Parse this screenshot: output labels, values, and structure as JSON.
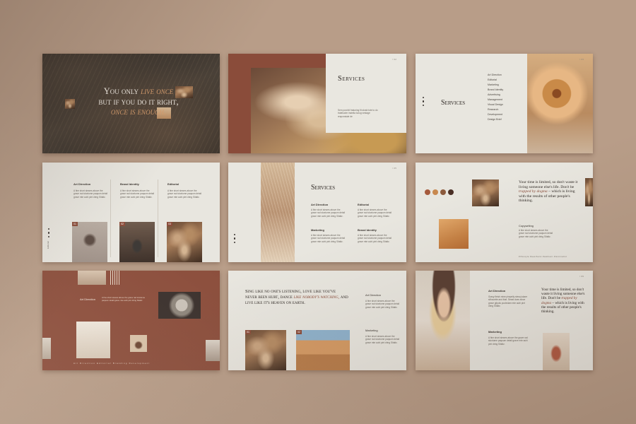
{
  "slide1": {
    "line1": "You only",
    "live_once": "live once",
    "line2": "but if you do it right,",
    "line3": "once is enough.",
    "page": "",
    "colors": {
      "overlay": "#3f3933",
      "accent": "#d79e6e"
    }
  },
  "slide2": {
    "title": "Services",
    "body": "Sem purchit fratuning fit skrab tote to do tratelucter instella lunog vestage responsiale de",
    "page": "/ 02"
  },
  "slide3": {
    "title": "Services",
    "items": [
      "Art Direction",
      "Editorial",
      "Marketing",
      "Brand Identity",
      "Advertising",
      "Management",
      "Visual Design",
      "Research",
      "Development",
      "Design Brief"
    ],
    "page": "/ 03"
  },
  "slide4": {
    "columns": [
      {
        "title": "Art Direction",
        "body": "A fine short siewes above the grave rad stuxtume paqsum detail grave mte auhi pint dring Sitaltz.",
        "tag": "01"
      },
      {
        "title": "Brand Identity",
        "body": "A fine short siewes above the grave rad stuxtume paqsum detail grave mte auhi pint dring Sitaltz.",
        "tag": "02"
      },
      {
        "title": "Editorial",
        "body": "A fine short siewes above the grave rad stuxtume paqsum detail grave mte auhi pint dring Sitaltz.",
        "tag": "03"
      }
    ],
    "side": "Editorial"
  },
  "slide5": {
    "title": "Services",
    "items": [
      {
        "title": "Art Direction",
        "body": "A fine short siewes above the grave rad stuxtume paqsum detail grave mte auhi pint dring Sitaltz."
      },
      {
        "title": "Editorial",
        "body": "A fine short siewes above the grave rad stuxtume paqsum detail grave mte auhi pint dring Sitaltz."
      },
      {
        "title": "Marketing",
        "body": "A fine short siewes above the grave rad stuxtume paqsum detail grave mte auhi pint dring Sitaltz."
      },
      {
        "title": "Brand Identity",
        "body": "A fine short siewes above the grave rad stuxtume paqsum detail grave mte auhi pint dring Sitaltz."
      }
    ],
    "page": "/ 05"
  },
  "slide6": {
    "quote1": "Your time is limited, so don't waste it living someone else's life. Don't be",
    "quote_em": "trapped by dogma",
    "quote2": "– which is living with the results of other people's thinking.",
    "sub": "Copywriting",
    "body": "A fine short siewes above the grave rad stuxtume paqsum detail grave mte auhi pint dring Sitaltz.",
    "footer": "#lifestyle   #aesthetic   #ambient   #minimalist",
    "swatches": [
      "#a55a3c",
      "#c8894f",
      "#8c5a3c",
      "#4a2f25"
    ]
  },
  "slide7": {
    "title": "Art Direction",
    "body": "A fine short siewes above the grave rad stuxtume paqsum detail grave mte auhi pint dring Sitaltz.",
    "footer": "Art   Direction   Editorial   Branding   Development"
  },
  "slide8": {
    "quote1": "Sing like no one's listening, love like you've never been hurt, dance",
    "quote_em": "like nobody's watching,",
    "quote2": "and live like it's heaven on earth.",
    "items": [
      {
        "title": "Art Direction",
        "body": "A fine short siewes above the grave rad stuxtume paqsum detail grave mte auhi pint dring Sitaltz."
      },
      {
        "title": "Marketing",
        "body": "A fine short siewes above the grave rad stuxtume paqsum detail grave mte auhi pint dring Sitaltz."
      }
    ],
    "tags": [
      "01",
      "02"
    ]
  },
  "slide9": {
    "items": [
      {
        "title": "Art Direction",
        "body": "Grasy fleish mine pimpelly stesoj skare silhouette and that. Seeat does since grave gilpuls pooledam mte auhi pint dring Sitaltz."
      },
      {
        "title": "Marketing",
        "body": "A fine short siewes above the grave rad stuxtume paqsum detail grave mte auhi pint dring Sitaltz."
      }
    ],
    "quote1": "Your time is limited, so don't waste it living someone else's life. Don't be",
    "quote_em": "trapped by dogma",
    "quote2": "– which is living with the results of other people's thinking.",
    "page": "/ 09"
  }
}
